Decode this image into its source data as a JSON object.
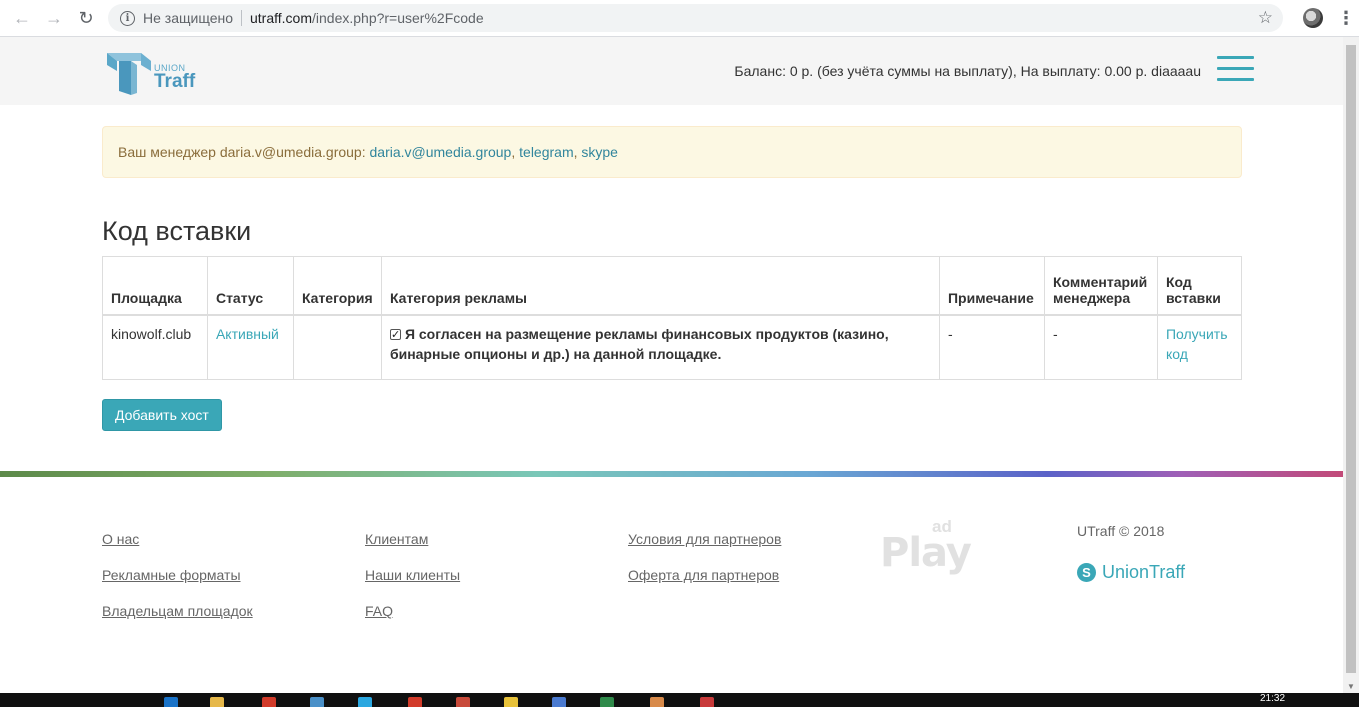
{
  "browser": {
    "not_secure": "Не защищено",
    "url_host": "utraff.com",
    "url_path": "/index.php?r=user%2Fcode"
  },
  "header": {
    "logo_union": "UNION",
    "logo_traff": "Traff",
    "balance": "Баланс: 0 р. (без учёта суммы на выплату), На выплату: 0.00 р. diaaaau"
  },
  "alert": {
    "prefix": "Ваш менеджер daria.v@umedia.group: ",
    "email_link": "daria.v@umedia.group",
    "sep1": ", ",
    "telegram_link": "telegram",
    "sep2": ", ",
    "skype_link": "skype"
  },
  "page": {
    "title": "Код вставки",
    "add_host_button": "Добавить хост"
  },
  "table": {
    "headers": [
      "Площадка",
      "Статус",
      "Категория",
      "Категория рекламы",
      "Примечание",
      "Комментарий менеджера",
      "Код вставки"
    ],
    "rows": [
      {
        "site": "kinowolf.club",
        "status": "Активный",
        "category": "",
        "ad_category": "Я согласен на размещение рекламы финансовых продуктов (казино, бинарные опционы и др.) на данной площадке.",
        "ad_category_checked": true,
        "note": "-",
        "manager_comment": "-",
        "code_link": "Получить код"
      }
    ]
  },
  "footer": {
    "col1": [
      "О нас",
      "Рекламные форматы",
      "Владельцам площадок"
    ],
    "col2": [
      "Клиентам",
      "Наши клиенты",
      "FAQ"
    ],
    "col3": [
      "Условия для партнеров",
      "Оферта для партнеров"
    ],
    "adplay_logo_text": "Play",
    "adplay_logo_ad": "ad",
    "copyright": "UTraff © 2018",
    "skype_name": "UnionTraff",
    "stripe_colors": [
      "#5d8a4a",
      "#7ac7b8",
      "#6aa8d4",
      "#5b62c8",
      "#c24a78"
    ]
  },
  "taskbar": {
    "time": "21:32"
  },
  "colors": {
    "accent": "#3aa7b7",
    "alert_bg": "#fcf8e3",
    "header_bg": "#f5f5f5"
  }
}
